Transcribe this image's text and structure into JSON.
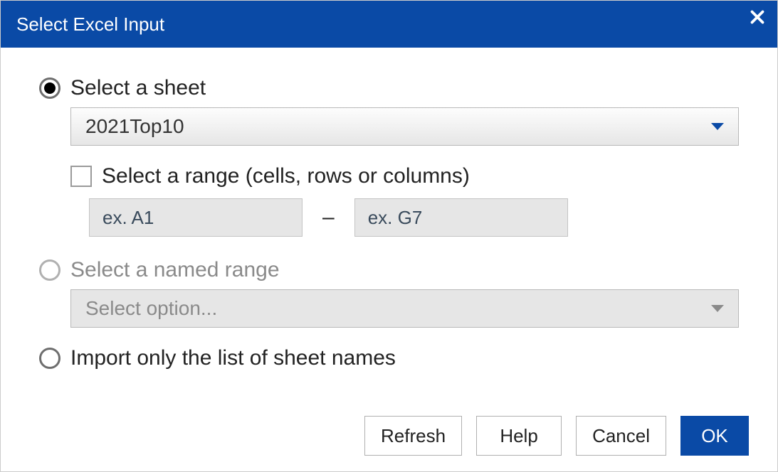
{
  "title": "Select Excel Input",
  "options": {
    "select_sheet": {
      "label": "Select a sheet",
      "sheet_dropdown_value": "2021Top10",
      "range_checkbox_label": "Select a range (cells, rows or columns)",
      "range_from_placeholder": "ex. A1",
      "range_to_placeholder": "ex. G7"
    },
    "named_range": {
      "label": "Select a named range",
      "dropdown_placeholder": "Select option..."
    },
    "import_list": {
      "label": "Import only the list of sheet names"
    }
  },
  "buttons": {
    "refresh": "Refresh",
    "help": "Help",
    "cancel": "Cancel",
    "ok": "OK"
  }
}
